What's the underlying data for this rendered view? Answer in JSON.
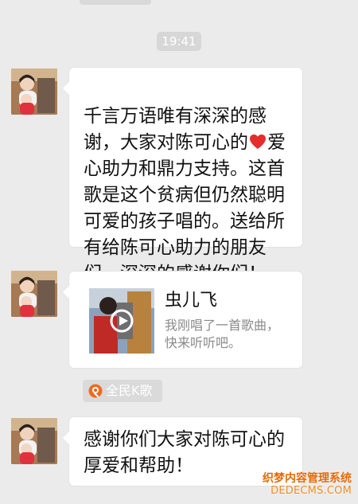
{
  "chat": {
    "timestamp": "19:41",
    "messages": [
      {
        "type": "text",
        "content_before_heart": "千言万语唯有深深的感谢，大家对陈可心的",
        "content_after_heart": "爱心助力和鼎力支持。这首歌是这个贫病但仍然聪明可爱的孩子唱的。送给所有给陈可心助力的朋友们。深深的感谢你们！",
        "avatar_icon": "avatar-icon"
      },
      {
        "type": "song-card",
        "title": "虫儿飞",
        "description": "我刚唱了一首歌曲，快来听听吧。",
        "thumbnail_icon": "play-icon",
        "avatar_icon": "avatar-icon"
      },
      {
        "type": "text",
        "content": "感谢你们大家对陈可心的厚爱和帮助！",
        "avatar_icon": "avatar-icon"
      }
    ],
    "source_label": "全民K歌",
    "source_icon": "kge-icon"
  },
  "watermark": {
    "line1": "织梦内容管理系统",
    "line2": "DEDECMS.COM"
  },
  "colors": {
    "background": "#ebebeb",
    "bubble": "#ffffff",
    "timestamp_pill": "#d7d7d7",
    "source_pill": "#dadada",
    "heart": "#e62c2c",
    "brand_orange": "#f06a1f"
  }
}
